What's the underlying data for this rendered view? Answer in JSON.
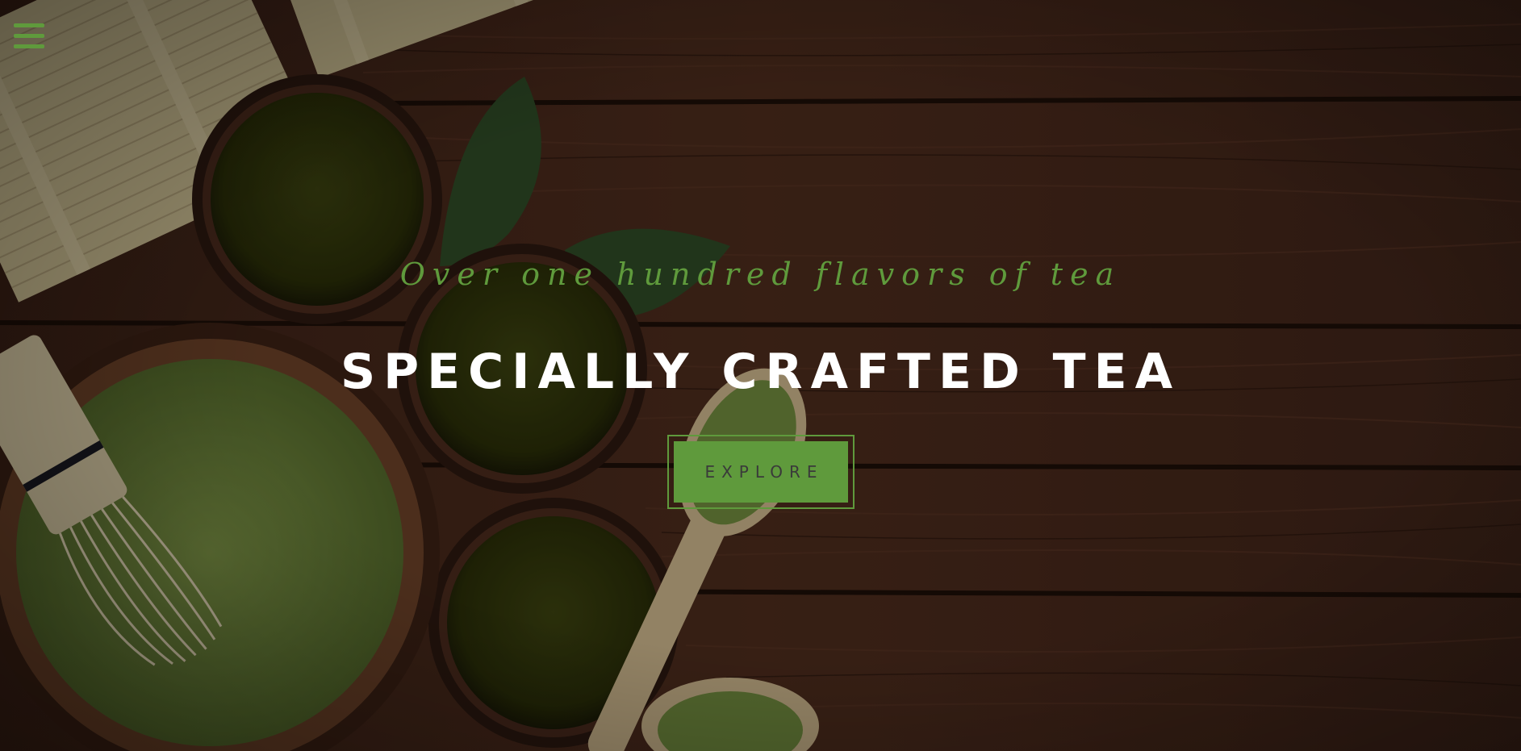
{
  "hero": {
    "tagline": "Over one hundred flavors of tea",
    "headline": "SPECIALLY CRAFTED TEA",
    "cta_label": "EXPLORE"
  },
  "nav": {
    "menu_icon": "hamburger-icon"
  },
  "colors": {
    "accent": "#5f9a3c",
    "headline": "#ffffff",
    "wood_dark": "#2a1710",
    "wood_mid": "#4a2a1c",
    "tea": "#2e3308"
  }
}
